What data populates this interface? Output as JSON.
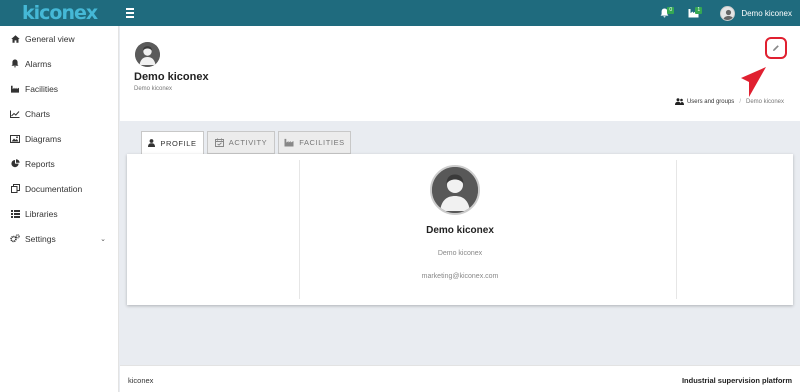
{
  "brand": {
    "logo_text": "kiconex"
  },
  "topbar": {
    "alarms_badge": "0",
    "facilities_badge": "1",
    "user_name": "Demo kiconex"
  },
  "sidebar": {
    "items": [
      {
        "label": "General view",
        "icon": "home-icon"
      },
      {
        "label": "Alarms",
        "icon": "bell-icon"
      },
      {
        "label": "Facilities",
        "icon": "factory-icon"
      },
      {
        "label": "Charts",
        "icon": "line-chart-icon"
      },
      {
        "label": "Diagrams",
        "icon": "image-icon"
      },
      {
        "label": "Reports",
        "icon": "pie-chart-icon"
      },
      {
        "label": "Documentation",
        "icon": "documents-icon"
      },
      {
        "label": "Libraries",
        "icon": "list-icon"
      },
      {
        "label": "Settings",
        "icon": "gears-icon",
        "has_submenu": true
      }
    ]
  },
  "page_header": {
    "title": "Demo kiconex",
    "subtitle": "Demo kiconex",
    "breadcrumb": {
      "parent": "Users and groups",
      "current": "Demo kiconex"
    }
  },
  "tabs": [
    {
      "label": "PROFILE",
      "active": true
    },
    {
      "label": "ACTIVITY",
      "active": false
    },
    {
      "label": "FACILITIES",
      "active": false
    }
  ],
  "profile": {
    "name": "Demo kiconex",
    "subtitle": "Demo kiconex",
    "email": "marketing@kiconex.com"
  },
  "footer": {
    "left": "kiconex",
    "right": "Industrial supervision platform"
  },
  "colors": {
    "topbar": "#1f6b7e",
    "logo": "#45b8d6",
    "badge": "#35a853",
    "highlight": "#e02030",
    "background": "#e9ecf1"
  }
}
